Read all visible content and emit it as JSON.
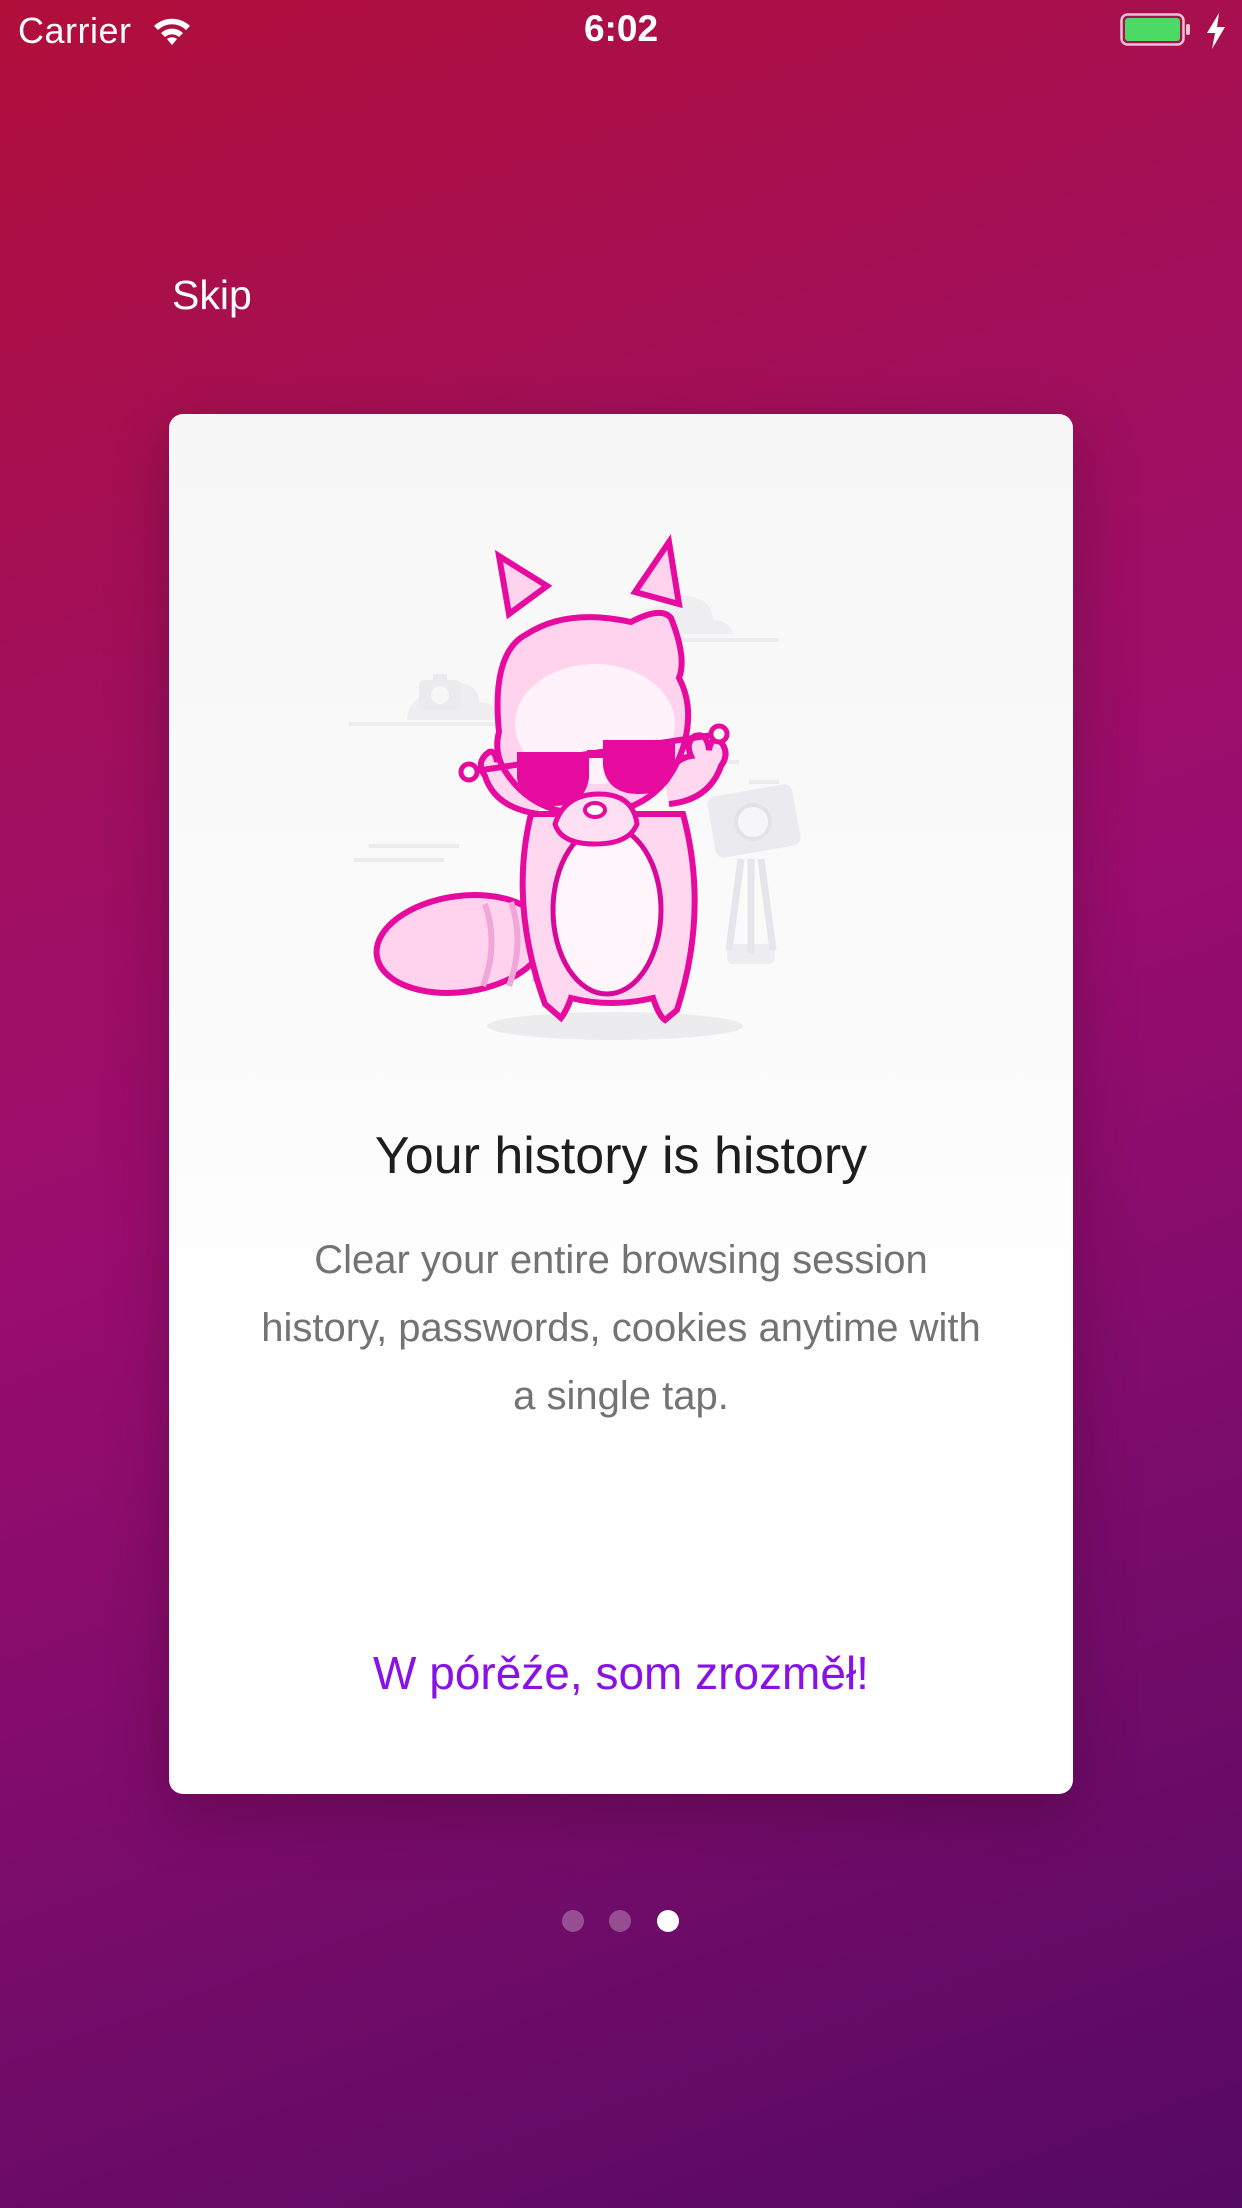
{
  "status_bar": {
    "carrier": "Carrier",
    "time": "6:02",
    "battery_color": "#4cd964"
  },
  "onboarding": {
    "skip_label": "Skip",
    "title": "Your history is history",
    "description": "Clear your entire browsing session history, passwords, cookies anytime with a single tap.",
    "cta_label": "W pórěźe, som zrozměł!",
    "page_count": 3,
    "active_page": 3
  },
  "colors": {
    "accent": "#8a11e6",
    "mascot_pink": "#e60a9e",
    "background_start": "#b10f3a",
    "background_end": "#550a63"
  },
  "icons": {
    "wifi": "wifi-icon",
    "battery": "battery-icon",
    "charging": "charging-bolt-icon",
    "mascot": "raccoon-mascot-illustration"
  }
}
